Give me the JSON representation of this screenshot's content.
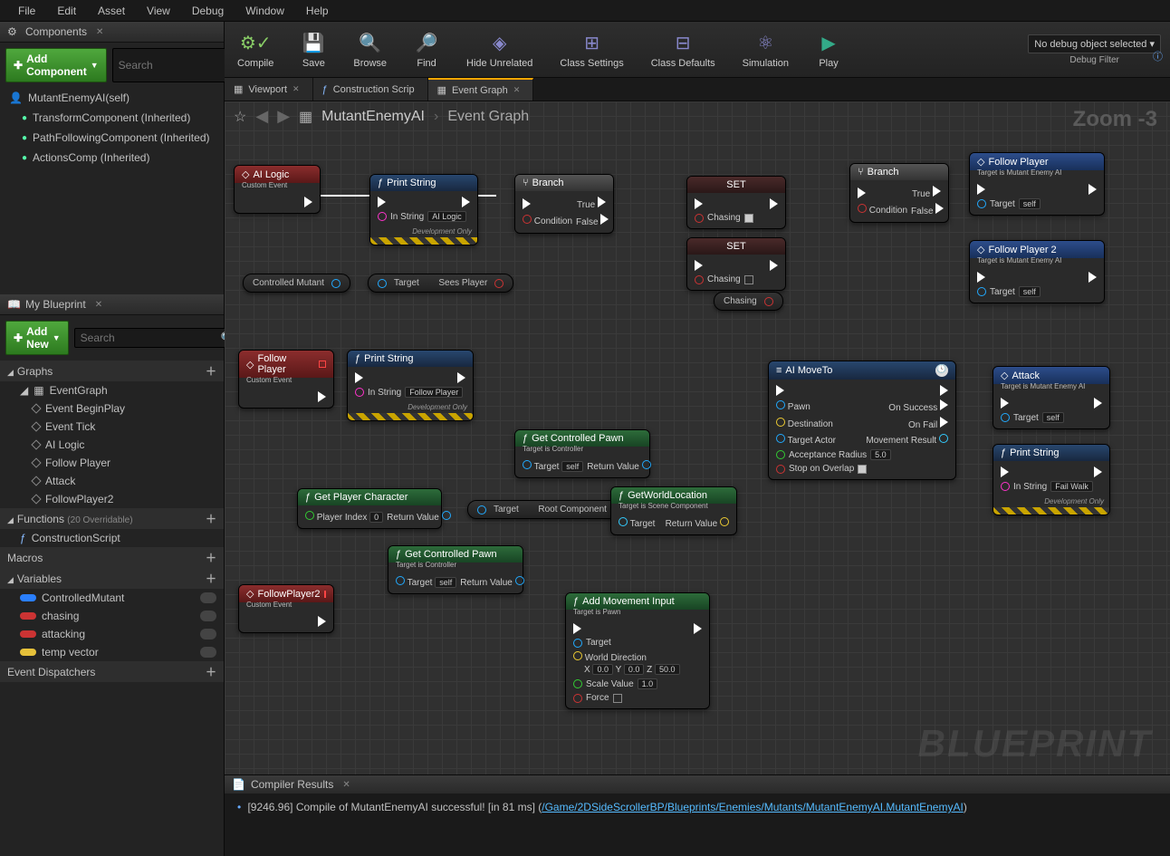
{
  "menu": [
    "File",
    "Edit",
    "Asset",
    "View",
    "Debug",
    "Window",
    "Help"
  ],
  "components": {
    "title": "Components",
    "add": "Add Component",
    "search_placeholder": "Search",
    "items": [
      {
        "label": "MutantEnemyAI(self)",
        "nested": false
      },
      {
        "label": "TransformComponent (Inherited)",
        "nested": true
      },
      {
        "label": "PathFollowingComponent (Inherited)",
        "nested": true
      },
      {
        "label": "ActionsComp (Inherited)",
        "nested": true
      }
    ]
  },
  "myblueprint": {
    "title": "My Blueprint",
    "add": "Add New",
    "search_placeholder": "Search",
    "graphs": {
      "title": "Graphs",
      "root": "EventGraph",
      "items": [
        "Event BeginPlay",
        "Event Tick",
        "AI Logic",
        "Follow Player",
        "Attack",
        "FollowPlayer2"
      ]
    },
    "functions": {
      "title": "Functions",
      "suffix": "(20 Overridable)",
      "items": [
        "ConstructionScript"
      ]
    },
    "macros": "Macros",
    "variables": {
      "title": "Variables",
      "items": [
        {
          "label": "ControlledMutant",
          "color": "blue"
        },
        {
          "label": "chasing",
          "color": "red"
        },
        {
          "label": "attacking",
          "color": "red"
        },
        {
          "label": "temp vector",
          "color": "yellow"
        }
      ]
    },
    "dispatchers": "Event Dispatchers"
  },
  "toolbar": {
    "compile": "Compile",
    "save": "Save",
    "browse": "Browse",
    "find": "Find",
    "hide": "Hide Unrelated",
    "csettings": "Class Settings",
    "cdefaults": "Class Defaults",
    "sim": "Simulation",
    "play": "Play",
    "debug_sel": "No debug object selected",
    "debug_lbl": "Debug Filter"
  },
  "tabs": [
    {
      "label": "Viewport",
      "icon": "▦"
    },
    {
      "label": "Construction Scrip",
      "icon": "ƒ"
    },
    {
      "label": "Event Graph",
      "icon": "▦",
      "active": true
    }
  ],
  "breadcrumb": {
    "root": "MutantEnemyAI",
    "leaf": "Event Graph"
  },
  "zoom": "Zoom -3",
  "watermark": "BLUEPRINT",
  "nodes": {
    "ailogic": {
      "title": "AI Logic",
      "sub": "Custom Event"
    },
    "print1": {
      "title": "Print String",
      "in": "In String",
      "val": "AI Logic",
      "dev": "Development Only"
    },
    "branch1": {
      "title": "Branch",
      "cond": "Condition",
      "t": "True",
      "f": "False"
    },
    "set1": {
      "title": "SET",
      "var": "Chasing"
    },
    "set2": {
      "title": "SET",
      "var": "Chasing"
    },
    "branch2": {
      "title": "Branch",
      "cond": "Condition",
      "t": "True",
      "f": "False"
    },
    "follow_call": {
      "title": "Follow Player",
      "sub": "Target is Mutant Enemy AI",
      "tgt": "Target",
      "self": "self"
    },
    "follow2_call": {
      "title": "Follow Player 2",
      "sub": "Target is Mutant Enemy AI",
      "tgt": "Target",
      "self": "self"
    },
    "cm_pill": {
      "a": "Controlled Mutant",
      "t": "Target",
      "r": "Sees Player"
    },
    "chasing_pill": "Chasing",
    "followevt": {
      "title": "Follow Player",
      "sub": "Custom Event"
    },
    "print2": {
      "title": "Print String",
      "in": "In String",
      "val": "Follow Player",
      "dev": "Development Only"
    },
    "aimove": {
      "title": "AI MoveTo",
      "pawn": "Pawn",
      "dest": "Destination",
      "actor": "Target Actor",
      "rad": "Acceptance Radius",
      "radv": "5.0",
      "stop": "Stop on Overlap",
      "succ": "On Success",
      "fail": "On Fail",
      "mres": "Movement Result"
    },
    "attack_call": {
      "title": "Attack",
      "sub": "Target is Mutant Enemy AI",
      "tgt": "Target",
      "self": "self"
    },
    "print3": {
      "title": "Print String",
      "in": "In String",
      "val": "Fail Walk",
      "dev": "Development Only"
    },
    "gcp": {
      "title": "Get Controlled Pawn",
      "sub": "Target is Controller",
      "tgt": "Target",
      "self": "self",
      "rv": "Return Value"
    },
    "gpc": {
      "title": "Get Player Character",
      "pi": "Player Index",
      "piv": "0",
      "rv": "Return Value"
    },
    "tr_pill": {
      "t": "Target",
      "r": "Root Component"
    },
    "gwl": {
      "title": "GetWorldLocation",
      "sub": "Target is Scene Component",
      "tgt": "Target",
      "rv": "Return Value"
    },
    "gcp2": {
      "title": "Get Controlled Pawn",
      "sub": "Target is Controller",
      "tgt": "Target",
      "self": "self",
      "rv": "Return Value"
    },
    "fp2evt": {
      "title": "FollowPlayer2",
      "sub": "Custom Event"
    },
    "ami": {
      "title": "Add Movement Input",
      "sub": "Target is Pawn",
      "tgt": "Target",
      "wd": "World Direction",
      "x": "0.0",
      "y": "0.0",
      "z": "50.0",
      "sv": "Scale Value",
      "svv": "1.0",
      "force": "Force"
    }
  },
  "compiler": {
    "title": "Compiler Results",
    "msg_pre": "[9246.96] Compile of MutantEnemyAI successful! [in 81 ms] (",
    "msg_link": "/Game/2DSideScrollerBP/Blueprints/Enemies/Mutants/MutantEnemyAI.MutantEnemyAI",
    "msg_post": ")"
  }
}
